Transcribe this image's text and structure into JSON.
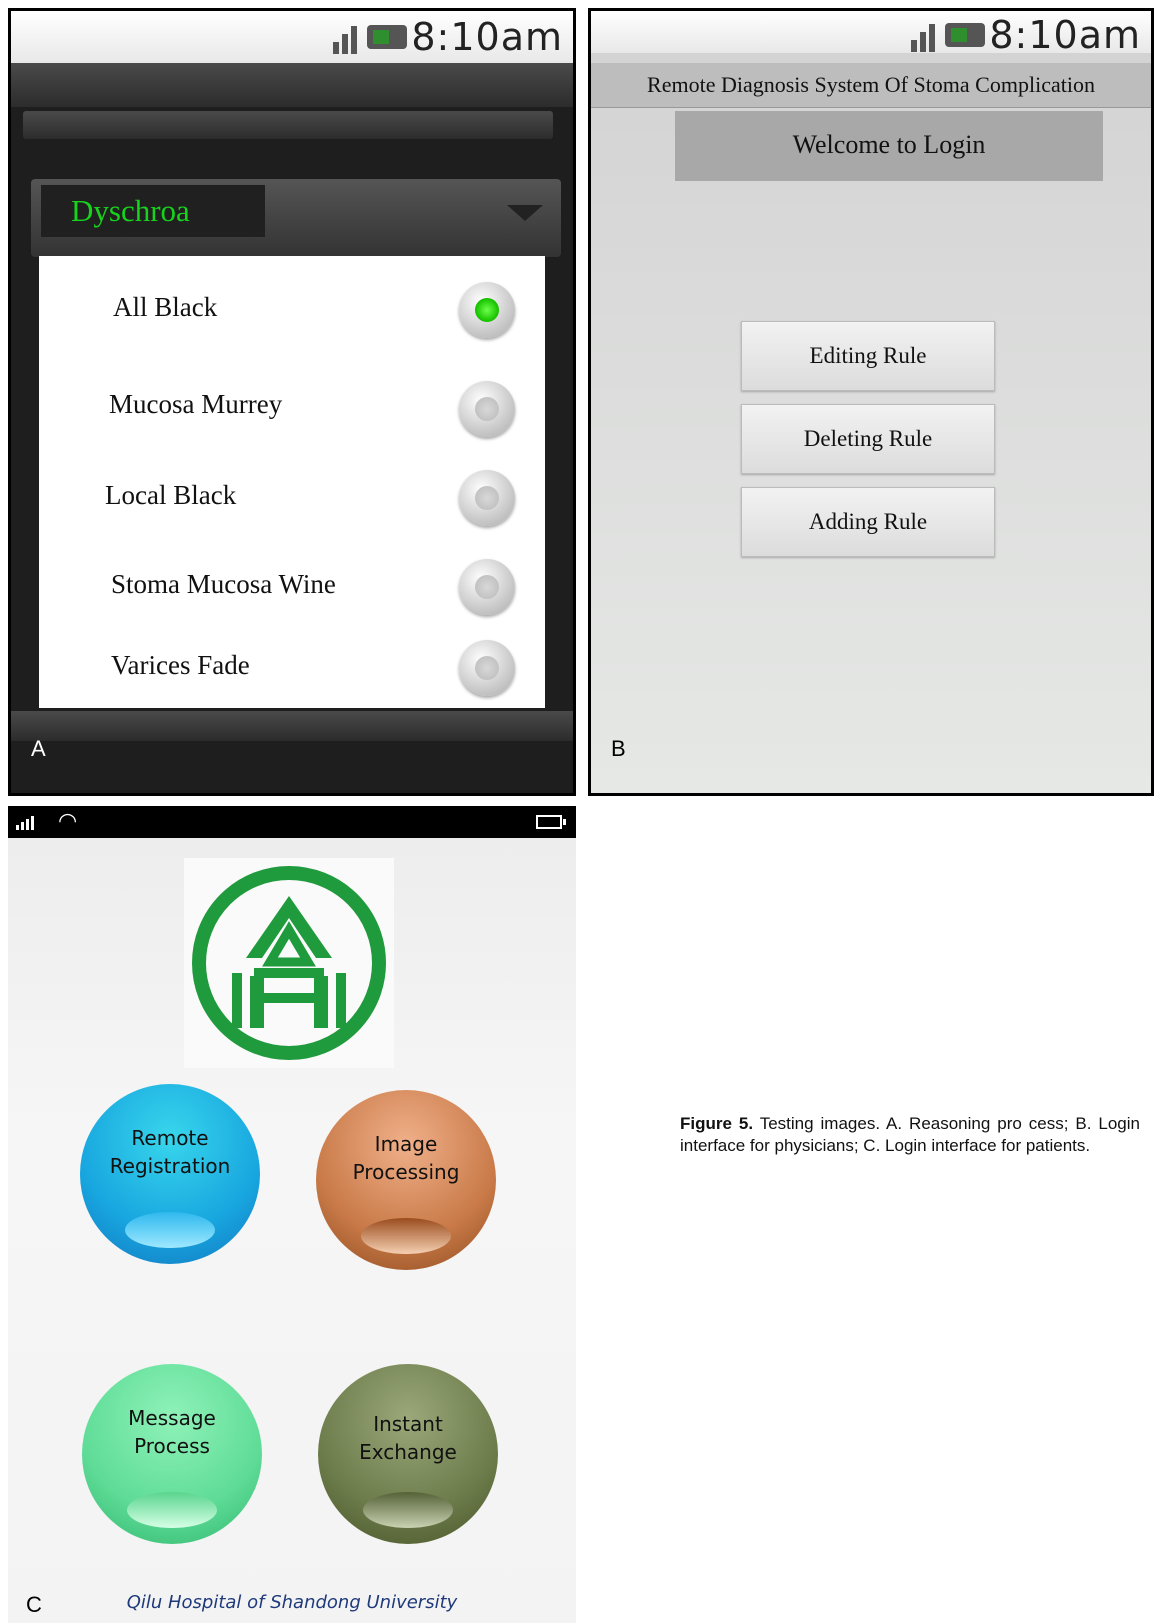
{
  "panel_a": {
    "status_time": "8:10am",
    "dropdown_value": "Dyschroa",
    "options": [
      {
        "label": "All Black",
        "selected": true
      },
      {
        "label": "Mucosa Murrey",
        "selected": false
      },
      {
        "label": "Local Black",
        "selected": false
      },
      {
        "label": "Stoma Mucosa Wine",
        "selected": false
      },
      {
        "label": "Varices Fade",
        "selected": false
      }
    ],
    "letter": "A",
    "colors": {
      "dropdown_text": "#17d31b",
      "radio_selected": "#19c400"
    }
  },
  "panel_b": {
    "status_time": "8:10am",
    "app_title": "Remote Diagnosis System Of Stoma Complication",
    "welcome": "Welcome to Login",
    "buttons": [
      "Editing Rule",
      "Deleting Rule",
      "Adding Rule"
    ],
    "letter": "B"
  },
  "panel_c": {
    "status_icons": [
      "signal-icon",
      "wifi-icon",
      "battery-icon"
    ],
    "logo": "hospital-logo-icon",
    "bubbles": [
      {
        "line1": "Remote",
        "line2": "Registration",
        "color": "#18a6df"
      },
      {
        "line1": "Image",
        "line2": "Processing",
        "color": "#c97a48"
      },
      {
        "line1": "Message",
        "line2": "Process",
        "color": "#5fdc97"
      },
      {
        "line1": "Instant",
        "line2": "Exchange",
        "color": "#6d7c4b"
      }
    ],
    "hospital_name": "Qilu Hospital of Shandong University",
    "letter": "C",
    "colors": {
      "logo_green": "#1f9a3c",
      "hospital_text": "#1f3a7a"
    }
  },
  "caption": {
    "label": "Figure 5.",
    "text": " Testing images. A. Reasoning pro cess; B. Login interface for physicians; C. Login interface for patients."
  }
}
